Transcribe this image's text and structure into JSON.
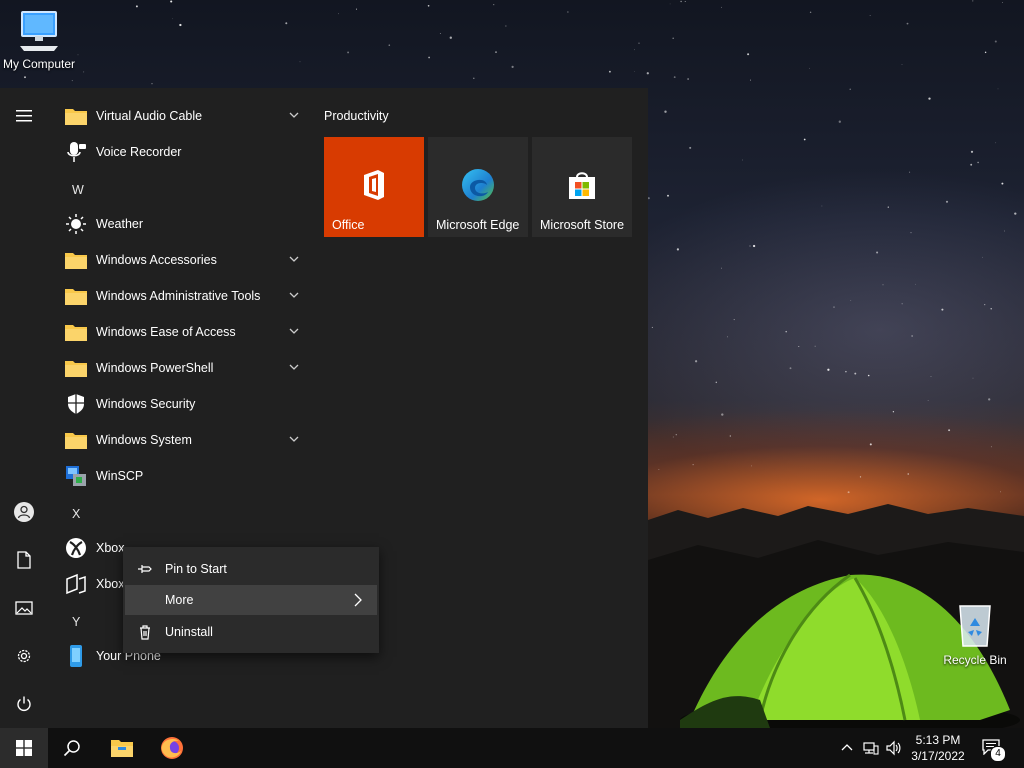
{
  "desktop": {
    "my_computer_label": "My Computer",
    "recycle_bin_label": "Recycle Bin"
  },
  "start_menu": {
    "apps": [
      {
        "label": "Virtual Audio Cable",
        "icon": "folder-icon",
        "expandable": true
      },
      {
        "label": "Voice Recorder",
        "icon": "microphone-icon",
        "expandable": false
      },
      {
        "letter": "W"
      },
      {
        "label": "Weather",
        "icon": "sun-icon",
        "expandable": false
      },
      {
        "label": "Windows Accessories",
        "icon": "folder-icon",
        "expandable": true
      },
      {
        "label": "Windows Administrative Tools",
        "icon": "folder-icon",
        "expandable": true
      },
      {
        "label": "Windows Ease of Access",
        "icon": "folder-icon",
        "expandable": true
      },
      {
        "label": "Windows PowerShell",
        "icon": "folder-icon",
        "expandable": true
      },
      {
        "label": "Windows Security",
        "icon": "shield-icon",
        "expandable": false
      },
      {
        "label": "Windows System",
        "icon": "folder-icon",
        "expandable": true
      },
      {
        "label": "WinSCP",
        "icon": "winscp-icon",
        "expandable": false
      },
      {
        "letter": "X"
      },
      {
        "label": "Xbox",
        "icon": "xbox-icon",
        "expandable": false
      },
      {
        "label": "Xbox",
        "icon": "xbox-game-bar-icon",
        "expandable": false
      },
      {
        "letter": "Y"
      },
      {
        "label": "Your Phone",
        "icon": "phone-icon",
        "expandable": false
      }
    ],
    "tile_group_title": "Productivity",
    "tiles": [
      {
        "label": "Office",
        "color": "#d83b01",
        "icon": "office-icon"
      },
      {
        "label": "Microsoft Edge",
        "color": "#2b2b2b",
        "icon": "edge-icon"
      },
      {
        "label": "Microsoft Store",
        "color": "#2b2b2b",
        "icon": "store-icon"
      }
    ]
  },
  "context_menu": {
    "items": [
      {
        "label": "Pin to Start",
        "icon": "pin-icon"
      },
      {
        "label": "More",
        "icon": "chevron-right-icon"
      },
      {
        "label": "Uninstall",
        "icon": "trash-icon"
      }
    ]
  },
  "taskbar": {
    "time": "5:13 PM",
    "date": "3/17/2022",
    "notification_count": "4"
  },
  "colors": {
    "start_bg": "#202020",
    "taskbar_bg": "#101010",
    "office_orange": "#d83b01",
    "tile_gray": "#2b2b2b",
    "folder_yellow": "#f8c84a"
  }
}
